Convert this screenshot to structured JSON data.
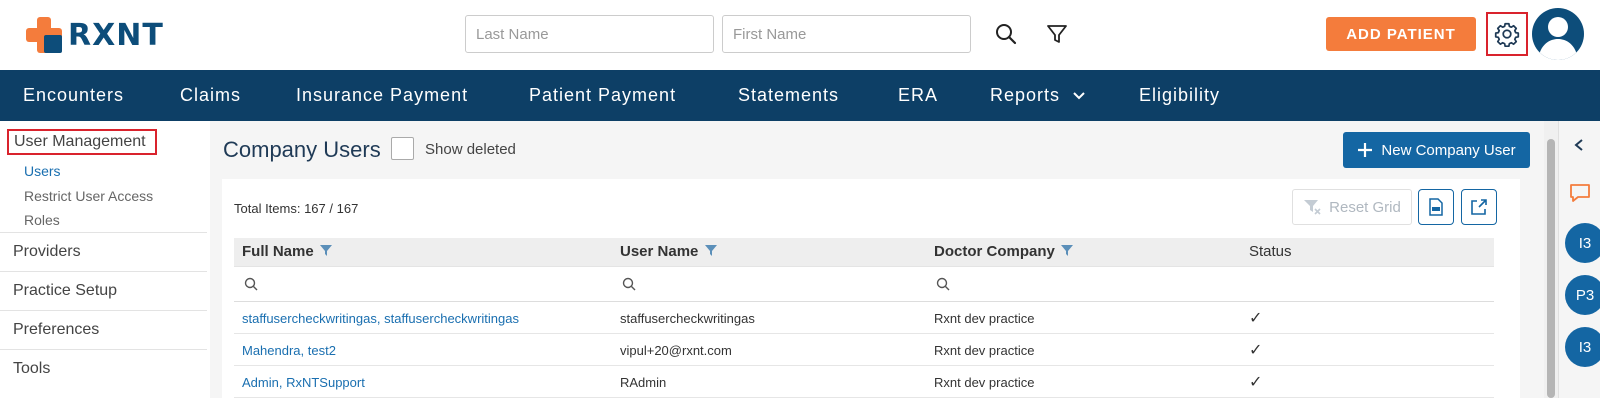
{
  "header": {
    "logo_text": "RXNT",
    "last_name_placeholder": "Last Name",
    "first_name_placeholder": "First Name",
    "add_patient_label": "ADD PATIENT"
  },
  "nav": {
    "items": [
      "Encounters",
      "Claims",
      "Insurance Payment",
      "Patient Payment",
      "Statements",
      "ERA",
      "Reports",
      "Eligibility"
    ]
  },
  "sidebar": {
    "heading": "User Management",
    "sub_items": [
      "Users",
      "Restrict User Access",
      "Roles"
    ],
    "sections": [
      "Providers",
      "Practice Setup",
      "Preferences",
      "Tools"
    ]
  },
  "main": {
    "title": "Company Users",
    "show_deleted_label": "Show deleted",
    "new_user_label": "New Company User",
    "total_items": "Total Items: 167 / 167",
    "reset_grid_label": "Reset Grid"
  },
  "grid": {
    "columns": [
      "Full Name",
      "User Name",
      "Doctor Company",
      "Status"
    ],
    "rows": [
      {
        "full_name": "staffusercheckwritingas, staffusercheckwritingas",
        "user_name": "staffusercheckwritingas",
        "company": "Rxnt dev practice",
        "status": "✓"
      },
      {
        "full_name": "Mahendra, test2",
        "user_name": "vipul+20@rxnt.com",
        "company": "Rxnt dev practice",
        "status": "✓"
      },
      {
        "full_name": "Admin, RxNTSupport",
        "user_name": "RAdmin",
        "company": "Rxnt dev practice",
        "status": "✓"
      }
    ]
  },
  "rail": {
    "badges": [
      "I3",
      "P3",
      "I3"
    ]
  },
  "colors": {
    "brand_navy": "#0d3f66",
    "brand_orange": "#f47c3c",
    "primary_blue": "#1466a3",
    "highlight_red": "#d9232d"
  }
}
